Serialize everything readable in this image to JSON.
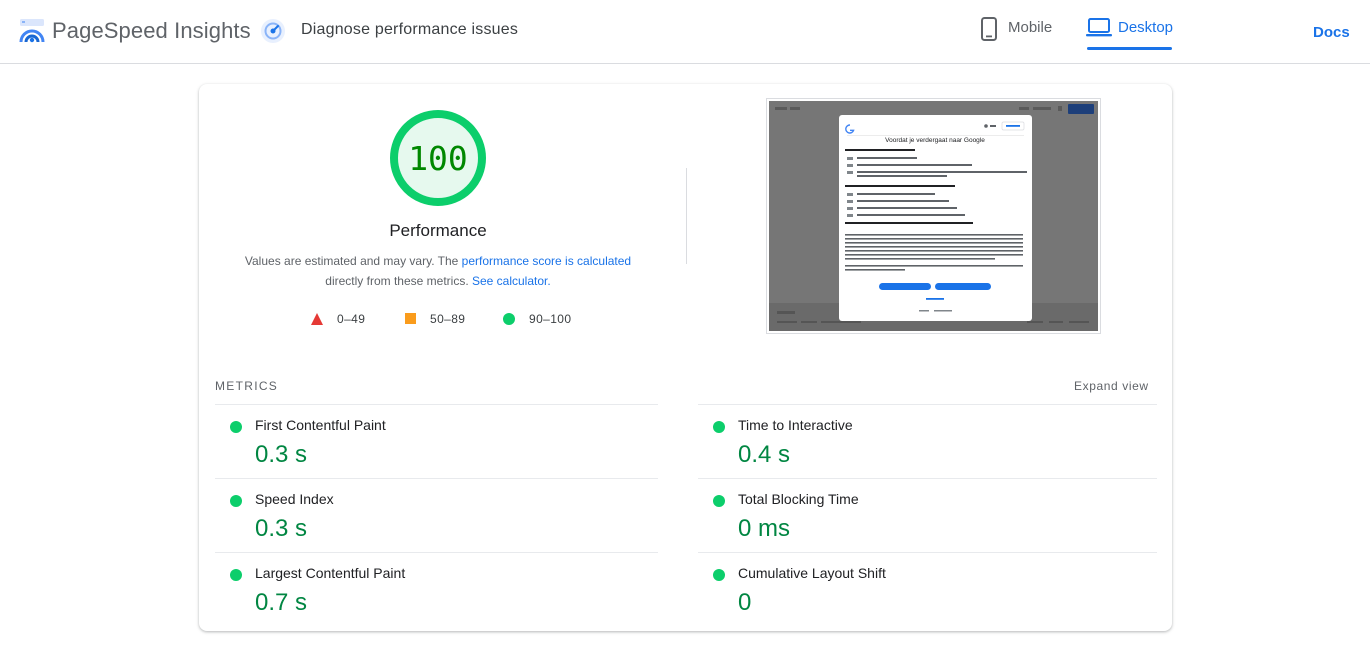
{
  "header": {
    "app_title": "PageSpeed Insights",
    "diagnose_label": "Diagnose performance issues",
    "tabs": [
      {
        "label": "Mobile",
        "active": false
      },
      {
        "label": "Desktop",
        "active": true
      }
    ],
    "docs_label": "Docs",
    "accent_color": "#1a73e8"
  },
  "performance": {
    "score": "100",
    "title": "Performance",
    "desc_prefix": "Values are estimated and may vary. The ",
    "desc_link": "performance score is calculated",
    "desc_middle": " directly from these metrics. ",
    "calc_link": "See calculator.",
    "pass_color": "#0cce6b"
  },
  "legend": [
    {
      "range": "0–49",
      "color": "#e53935",
      "shape": "triangle"
    },
    {
      "range": "50–89",
      "color": "#fa9c1c",
      "shape": "square"
    },
    {
      "range": "90–100",
      "color": "#0cce6b",
      "shape": "circle"
    }
  ],
  "screenshot": {
    "dialog_title": "Voordat je verdergaat naar Google",
    "sign_in": "Inloggen",
    "btn_reject": "Alles afwijzen",
    "btn_accept": "Alles accepteren",
    "more_options": "Meer opties"
  },
  "metrics": {
    "title": "METRICS",
    "expand_label": "Expand view",
    "items": [
      {
        "label": "First Contentful Paint",
        "value": "0.3 s"
      },
      {
        "label": "Time to Interactive",
        "value": "0.4 s"
      },
      {
        "label": "Speed Index",
        "value": "0.3 s"
      },
      {
        "label": "Total Blocking Time",
        "value": "0 ms"
      },
      {
        "label": "Largest Contentful Paint",
        "value": "0.7 s"
      },
      {
        "label": "Cumulative Layout Shift",
        "value": "0"
      }
    ]
  }
}
